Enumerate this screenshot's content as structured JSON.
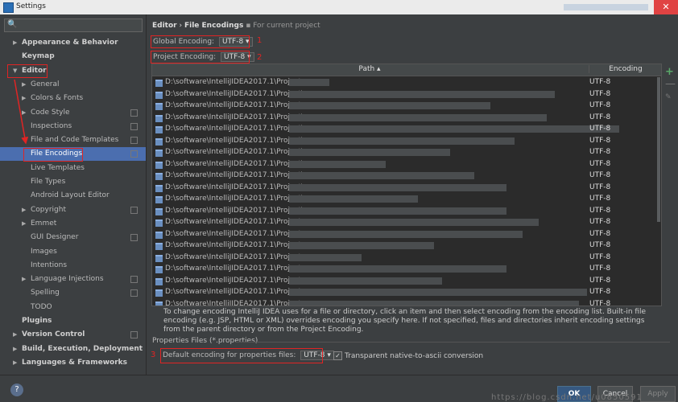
{
  "window": {
    "title": "Settings",
    "close_glyph": "✕"
  },
  "search": {
    "icon": "search-icon",
    "glyph": "🔍",
    "value": ""
  },
  "tree": [
    {
      "label": "Appearance & Behavior",
      "bold": true,
      "arrow": "▶",
      "indent": 0
    },
    {
      "label": "Keymap",
      "bold": true,
      "arrow": "",
      "indent": 0
    },
    {
      "label": "Editor",
      "bold": true,
      "arrow": "▼",
      "indent": 0
    },
    {
      "label": "General",
      "arrow": "▶",
      "indent": 1
    },
    {
      "label": "Colors & Fonts",
      "arrow": "▶",
      "indent": 1
    },
    {
      "label": "Code Style",
      "arrow": "▶",
      "indent": 1,
      "project": true
    },
    {
      "label": "Inspections",
      "arrow": "",
      "indent": 1,
      "project": true
    },
    {
      "label": "File and Code Templates",
      "arrow": "",
      "indent": 1,
      "project": true
    },
    {
      "label": "File Encodings",
      "arrow": "",
      "indent": 1,
      "project": true,
      "selected": true
    },
    {
      "label": "Live Templates",
      "arrow": "",
      "indent": 1
    },
    {
      "label": "File Types",
      "arrow": "",
      "indent": 1
    },
    {
      "label": "Android Layout Editor",
      "arrow": "",
      "indent": 1
    },
    {
      "label": "Copyright",
      "arrow": "▶",
      "indent": 1,
      "project": true
    },
    {
      "label": "Emmet",
      "arrow": "▶",
      "indent": 1
    },
    {
      "label": "GUI Designer",
      "arrow": "",
      "indent": 1,
      "project": true
    },
    {
      "label": "Images",
      "arrow": "",
      "indent": 1
    },
    {
      "label": "Intentions",
      "arrow": "",
      "indent": 1
    },
    {
      "label": "Language Injections",
      "arrow": "▶",
      "indent": 1,
      "project": true
    },
    {
      "label": "Spelling",
      "arrow": "",
      "indent": 1,
      "project": true
    },
    {
      "label": "TODO",
      "arrow": "",
      "indent": 1
    },
    {
      "label": "Plugins",
      "bold": true,
      "arrow": "",
      "indent": 0
    },
    {
      "label": "Version Control",
      "bold": true,
      "arrow": "▶",
      "indent": 0,
      "project": true
    },
    {
      "label": "Build, Execution, Deployment",
      "bold": true,
      "arrow": "▶",
      "indent": 0
    },
    {
      "label": "Languages & Frameworks",
      "bold": true,
      "arrow": "▶",
      "indent": 0
    }
  ],
  "breadcrumb": {
    "part1": "Editor",
    "sep": "›",
    "part2": "File Encodings",
    "hint": "For current project"
  },
  "global_encoding": {
    "label": "Global Encoding:",
    "value": "UTF-8 ▾",
    "annotation": "1"
  },
  "project_encoding": {
    "label": "Project Encoding:",
    "value": "UTF-8 ▾",
    "annotation": "2"
  },
  "table": {
    "header_path": "Path ▴",
    "header_encoding": "Encoding",
    "rows": [
      {
        "path": "D:\\software\\IntelliJIDEA2017.1\\Project",
        "encoding": "UTF-8"
      },
      {
        "path": "D:\\software\\IntelliJIDEA2017.1\\Project\\",
        "encoding": "UTF-8"
      },
      {
        "path": "D:\\software\\IntelliJIDEA2017.1\\Project",
        "encoding": "UTF-8"
      },
      {
        "path": "D:\\software\\IntelliJIDEA2017.1\\Project\\",
        "encoding": "UTF-8"
      },
      {
        "path": "D:\\software\\IntelliJIDEA2017.1\\Project\\",
        "encoding": "UTF-8"
      },
      {
        "path": "D:\\software\\IntelliJIDEA2017.1\\Project\\",
        "encoding": "UTF-8"
      },
      {
        "path": "D:\\software\\IntelliJIDEA2017.1\\Project\\yuyu",
        "encoding": "UTF-8"
      },
      {
        "path": "D:\\software\\IntelliJIDEA2017.1\\Project\\",
        "encoding": "UTF-8"
      },
      {
        "path": "D:\\software\\IntelliJIDEA2017.1\\Project\\",
        "encoding": "UTF-8"
      },
      {
        "path": "D:\\software\\IntelliJIDEA2017.1\\Project\\",
        "encoding": "UTF-8"
      },
      {
        "path": "D:\\software\\IntelliJIDEA2017.1\\Project\\",
        "encoding": "UTF-8"
      },
      {
        "path": "D:\\software\\IntelliJIDEA2017.1\\Project\\",
        "encoding": "UTF-8"
      },
      {
        "path": "D:\\software\\IntelliJIDEA2017.1\\Project",
        "encoding": "UTF-8"
      },
      {
        "path": "D:\\software\\IntelliJIDEA2017.1\\Project",
        "encoding": "UTF-8"
      },
      {
        "path": "D:\\software\\IntelliJIDEA2017.1\\Project",
        "encoding": "UTF-8"
      },
      {
        "path": "D:\\software\\IntelliJIDEA2017.1\\Project",
        "encoding": "UTF-8"
      },
      {
        "path": "D:\\software\\IntelliJIDEA2017.1\\Project",
        "encoding": "UTF-8"
      },
      {
        "path": "D:\\software\\IntelliJIDEA2017.1\\Project",
        "encoding": "UTF-8"
      },
      {
        "path": "D:\\software\\IntelliJIDEA2017.1\\Project",
        "encoding": "UTF-8"
      },
      {
        "path": "D:\\software\\IntelliJIDEA2017.1\\Project",
        "encoding": "UTF-8"
      },
      {
        "path": "D:\\software\\IntelliJIDEA2017.1\\Project",
        "encoding": "UTF-8"
      }
    ]
  },
  "tools": {
    "plus": "+",
    "minus": "—",
    "edit": "✎"
  },
  "description": "To change encoding IntelliJ IDEA uses for a file or directory, click an item and then select encoding from the encoding list. Built-in file encoding (e.g. JSP, HTML or XML) overrides encoding you specify here. If not specified, files and directories inherit encoding settings from the parent directory or from the Project Encoding.",
  "properties": {
    "section_label": "Properties Files (*.properties)",
    "default_label": "Default encoding for properties files:",
    "default_value": "UTF-8 ▾",
    "annotation": "3",
    "transparent_label": "Transparent native-to-ascii conversion",
    "transparent_checked": "✓"
  },
  "footer": {
    "help": "?",
    "ok": "OK",
    "cancel": "Cancel",
    "apply": "Apply"
  },
  "watermark": "https://blog.csdn.net/u0850591"
}
